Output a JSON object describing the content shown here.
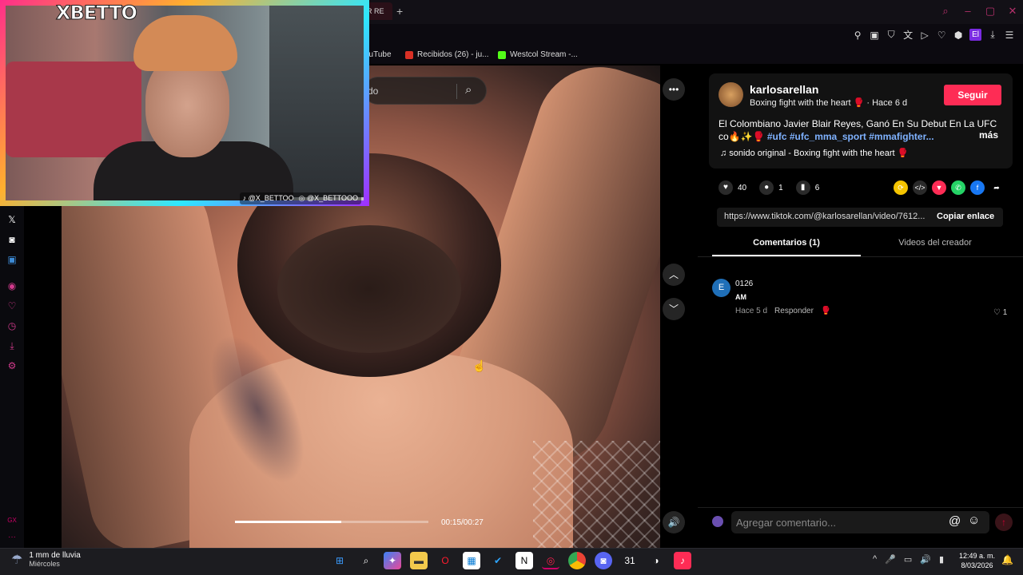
{
  "browser": {
    "active_tab_title": "R RE",
    "new_tab": "+",
    "window_controls": [
      "search",
      "minimize",
      "maximize",
      "close"
    ],
    "bookmarks": [
      {
        "label": "ouTube"
      },
      {
        "label": "Recibidos (26) - ju..."
      },
      {
        "label": "Westcol Stream -..."
      }
    ],
    "profile_badge": "El"
  },
  "sidebar": {
    "icons": [
      "x-icon",
      "discord-icon",
      "app-icon",
      "player-icon",
      "heart-icon",
      "history-icon",
      "download-icon",
      "settings-icon"
    ],
    "gx_label": "GX",
    "more": "···"
  },
  "webcam": {
    "name_part1": "X",
    "name_part2": "BETTO",
    "tiktok_handle": "@X_BETTOO",
    "instagram_handle": "@X_BETTOOO"
  },
  "video": {
    "search_placeholder": "do",
    "time": "00:15/00:27",
    "progress_fraction": 0.55
  },
  "post": {
    "author": "karlosarellan",
    "subtitle": "Boxing fight with the heart 🥊 · Hace 6 d",
    "follow_label": "Seguir",
    "description": "El Colombiano Javier Blair Reyes, Ganó En Su Debut En La UFC co🔥✨🥊 ",
    "hashtags": "#ufc #ufc_mma_sport #mmafighter...",
    "more_label": "más",
    "music": "♫  sonido original - Boxing fight with the heart 🥊",
    "likes": "40",
    "comments": "1",
    "saves": "6",
    "url": "https://www.tiktok.com/@karlosarellan/video/7612...",
    "copy_label": "Copiar enlace"
  },
  "tabs": {
    "comments": "Comentarios (1)",
    "creator_videos": "Videos del creador"
  },
  "comment": {
    "avatar_letter": "E",
    "name": "0126",
    "text": "AM",
    "time": "Hace 5 d",
    "reply_label": "Responder",
    "likes": "1"
  },
  "composer": {
    "placeholder": "Agregar comentario..."
  },
  "taskbar": {
    "weather_line1": "1 mm de lluvia",
    "weather_line2": "Miércoles",
    "time": "12:49 a. m.",
    "date": "8/03/2026"
  },
  "colors": {
    "tiktok_red": "#fe2c55",
    "hashtag_blue": "#7fb2ff",
    "opera_accent": "#d13a8c"
  }
}
